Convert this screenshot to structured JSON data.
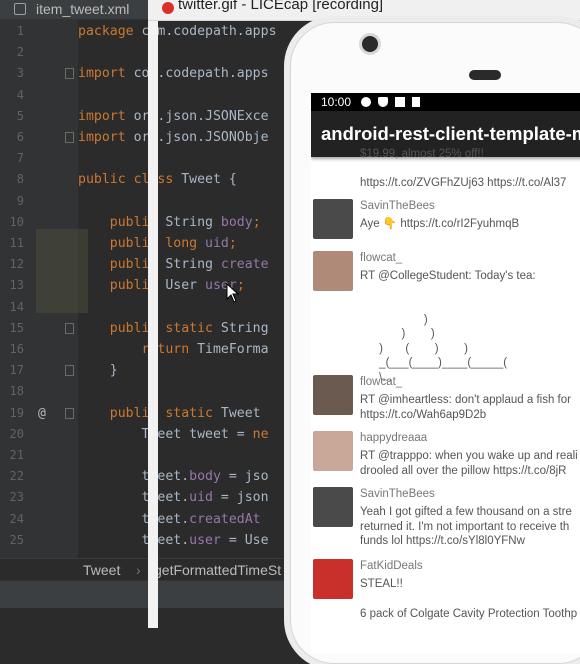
{
  "ide": {
    "tab_label": "item_tweet.xml",
    "lines": [
      {
        "num": "1",
        "parts": [
          {
            "t": "package ",
            "c": "kw"
          },
          {
            "t": "com.codepath.apps",
            "c": "id"
          }
        ]
      },
      {
        "num": "2",
        "parts": []
      },
      {
        "num": "3",
        "parts": [
          {
            "t": "import ",
            "c": "kw"
          },
          {
            "t": "com.codepath.apps",
            "c": "id"
          }
        ]
      },
      {
        "num": "4",
        "parts": []
      },
      {
        "num": "5",
        "parts": [
          {
            "t": "import ",
            "c": "kw"
          },
          {
            "t": "org.json.JSONExce",
            "c": "id"
          }
        ]
      },
      {
        "num": "6",
        "parts": [
          {
            "t": "import ",
            "c": "kw"
          },
          {
            "t": "org.json.JSONObje",
            "c": "id"
          }
        ]
      },
      {
        "num": "7",
        "parts": []
      },
      {
        "num": "8",
        "parts": [
          {
            "t": "public class ",
            "c": "kw"
          },
          {
            "t": "Tweet {",
            "c": "id"
          }
        ]
      },
      {
        "num": "9",
        "parts": []
      },
      {
        "num": "10",
        "parts": [
          {
            "t": "    public ",
            "c": "kw"
          },
          {
            "t": "String ",
            "c": "id"
          },
          {
            "t": "body",
            "c": "fld"
          },
          {
            "t": ";",
            "c": "kw"
          }
        ]
      },
      {
        "num": "11",
        "parts": [
          {
            "t": "    public long ",
            "c": "kw"
          },
          {
            "t": "uid",
            "c": "fld"
          },
          {
            "t": ";",
            "c": "kw"
          }
        ]
      },
      {
        "num": "12",
        "parts": [
          {
            "t": "    public ",
            "c": "kw"
          },
          {
            "t": "String ",
            "c": "id"
          },
          {
            "t": "create",
            "c": "fld"
          }
        ]
      },
      {
        "num": "13",
        "parts": [
          {
            "t": "    public ",
            "c": "kw"
          },
          {
            "t": "User ",
            "c": "id"
          },
          {
            "t": "user",
            "c": "fld"
          },
          {
            "t": ";",
            "c": "kw"
          }
        ]
      },
      {
        "num": "14",
        "parts": []
      },
      {
        "num": "15",
        "parts": [
          {
            "t": "    public static ",
            "c": "kw"
          },
          {
            "t": "String",
            "c": "id"
          }
        ]
      },
      {
        "num": "16",
        "parts": [
          {
            "t": "        return ",
            "c": "kw"
          },
          {
            "t": "TimeForma",
            "c": "id"
          }
        ]
      },
      {
        "num": "17",
        "parts": [
          {
            "t": "    }",
            "c": "id"
          }
        ]
      },
      {
        "num": "18",
        "parts": []
      },
      {
        "num": "19",
        "parts": [
          {
            "t": "    public static ",
            "c": "kw"
          },
          {
            "t": "Tweet",
            "c": "id"
          }
        ]
      },
      {
        "num": "20",
        "parts": [
          {
            "t": "        Tweet tweet = ",
            "c": "id"
          },
          {
            "t": "ne",
            "c": "kw"
          }
        ]
      },
      {
        "num": "21",
        "parts": []
      },
      {
        "num": "22",
        "parts": [
          {
            "t": "        tweet.",
            "c": "id"
          },
          {
            "t": "body",
            "c": "fld"
          },
          {
            "t": " = jso",
            "c": "id"
          }
        ]
      },
      {
        "num": "23",
        "parts": [
          {
            "t": "        tweet.",
            "c": "id"
          },
          {
            "t": "uid",
            "c": "fld"
          },
          {
            "t": " = json",
            "c": "id"
          }
        ]
      },
      {
        "num": "24",
        "parts": [
          {
            "t": "        tweet.",
            "c": "id"
          },
          {
            "t": "createdAt",
            "c": "fld"
          }
        ]
      },
      {
        "num": "25",
        "parts": [
          {
            "t": "        tweet.",
            "c": "id"
          },
          {
            "t": "user",
            "c": "fld"
          },
          {
            "t": " = Use",
            "c": "id"
          }
        ]
      }
    ],
    "override_marker": "@",
    "breadcrumb_class": "Tweet",
    "breadcrumb_sep": "›",
    "breadcrumb_method": "getFormattedTimeSt"
  },
  "licecap": {
    "title": "twitter.gif - LICEcap [recording]"
  },
  "phone": {
    "time": "10:00",
    "app_title": "android-rest-client-template-mast",
    "tweets": [
      {
        "name": "",
        "lines": [
          "$19.99, almost 25% off!!",
          "",
          "https://t.co/ZVGFhZUj63 https://t.co/Al37"
        ],
        "avatar": ""
      },
      {
        "name": "SavinTheBees",
        "lines": [
          "Aye 👇 https://t.co/rI2FyuhmqB"
        ],
        "avatar": "#4a4a4a"
      },
      {
        "name": "flowcat_",
        "lines": [
          "RT @CollegeStudent: Today's tea:",
          "",
          "",
          "                    )",
          "             )        )",
          "      )       (        )        )",
          "      _(___(____)____(_____(",
          "      \\..."
        ],
        "avatar": "#b08a78"
      },
      {
        "name": "flowcat_",
        "lines": [
          "RT @imheartless: don't applaud a fish for",
          "https://t.co/Wah6ap9D2b"
        ],
        "avatar": "#6b5a50"
      },
      {
        "name": "happydreaaa",
        "lines": [
          "RT @trapppo: when you wake up and reali",
          "drooled all over the pillow https://t.co/8jR"
        ],
        "avatar": "#c9a899"
      },
      {
        "name": "SavinTheBees",
        "lines": [
          "Yeah I got gifted a few thousand on a stre",
          "returned it. I'm not important to receive th",
          "funds lol https://t.co/sYl8l0YFNw"
        ],
        "avatar": "#4a4a4a"
      },
      {
        "name": "FatKidDeals",
        "lines": [
          "STEAL!!"
        ],
        "avatar": "#c9302c"
      },
      {
        "name": "",
        "lines": [
          "6 pack of Colgate Cavity Protection Toothp"
        ],
        "avatar": ""
      }
    ]
  },
  "colors": {
    "ide_bg": "#2b2b2b",
    "keyword": "#cc7832",
    "identifier": "#a9b7c6",
    "field": "#9876aa",
    "appbar": "#222222"
  },
  "icons": [
    "file-icon",
    "record-icon",
    "fold-icon",
    "settings-icon",
    "shield-icon",
    "play-icon",
    "sd-card-icon",
    "camera-icon",
    "speaker-icon",
    "mouse-cursor-icon"
  ]
}
